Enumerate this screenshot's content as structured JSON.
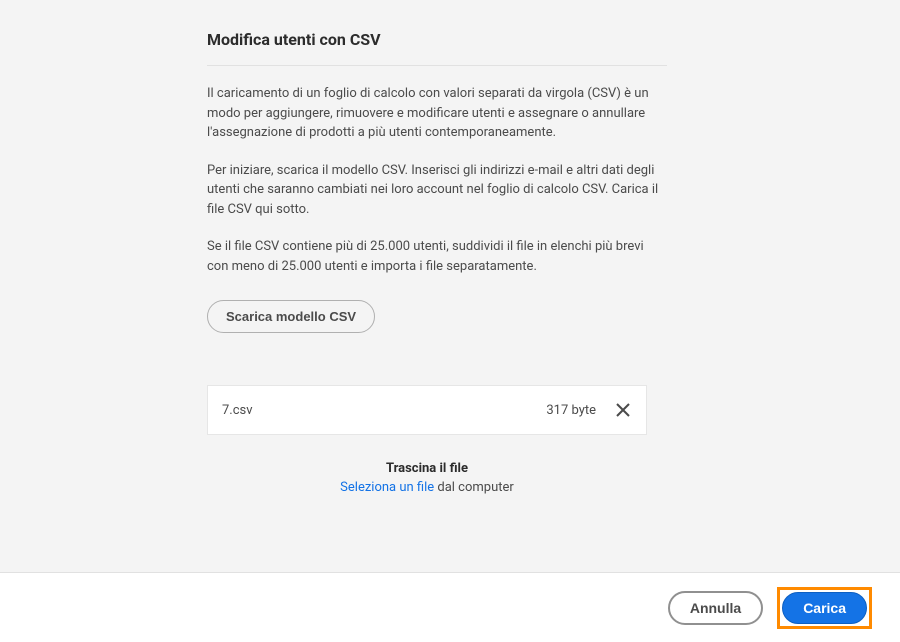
{
  "dialog": {
    "title": "Modifica utenti con CSV",
    "paragraph1": "Il caricamento di un foglio di calcolo con valori separati da virgola (CSV) è un modo per aggiungere, rimuovere e modificare utenti e assegnare o annullare l'assegnazione di prodotti a più utenti contemporaneamente.",
    "paragraph2": "Per iniziare, scarica il modello CSV. Inserisci gli indirizzi e-mail e altri dati degli utenti che saranno cambiati nei loro account nel foglio di calcolo CSV. Carica il file CSV qui sotto.",
    "paragraph3": "Se il file CSV contiene più di 25.000 utenti, suddividi il file in elenchi più brevi con meno di 25.000 utenti e importa i file separatamente.",
    "download_label": "Scarica modello CSV"
  },
  "file": {
    "name": "7.csv",
    "size": "317 byte"
  },
  "drop": {
    "title": "Trascina il file",
    "link": "Seleziona un file",
    "suffix": " dal computer"
  },
  "footer": {
    "cancel": "Annulla",
    "submit": "Carica"
  }
}
